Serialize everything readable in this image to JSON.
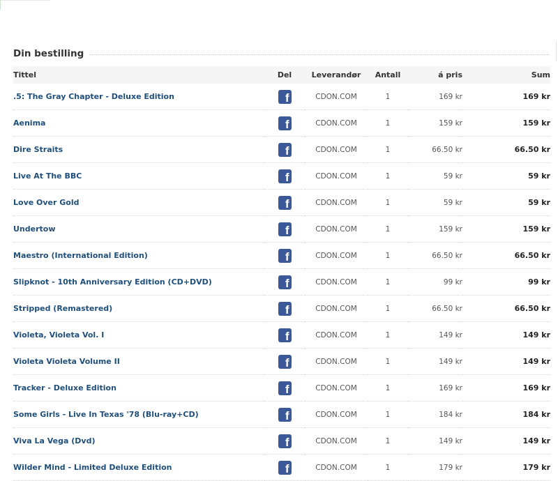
{
  "section": {
    "title": "Din bestilling"
  },
  "table": {
    "headers": {
      "title": "Tittel",
      "share": "Del",
      "supplier": "Leverandør",
      "quantity": "Antall",
      "unit_price": "á pris",
      "sum": "Sum"
    },
    "share_icon": "facebook-icon",
    "rows": [
      {
        "title": ".5: The Gray Chapter - Deluxe Edition",
        "supplier": "CDON.COM",
        "quantity": "1",
        "unit_price": "169 kr",
        "sum": "169 kr"
      },
      {
        "title": "Aenima",
        "supplier": "CDON.COM",
        "quantity": "1",
        "unit_price": "159 kr",
        "sum": "159 kr"
      },
      {
        "title": "Dire Straits",
        "supplier": "CDON.COM",
        "quantity": "1",
        "unit_price": "66.50 kr",
        "sum": "66.50 kr"
      },
      {
        "title": "Live At The BBC",
        "supplier": "CDON.COM",
        "quantity": "1",
        "unit_price": "59 kr",
        "sum": "59 kr"
      },
      {
        "title": "Love Over Gold",
        "supplier": "CDON.COM",
        "quantity": "1",
        "unit_price": "59 kr",
        "sum": "59 kr"
      },
      {
        "title": "Undertow",
        "supplier": "CDON.COM",
        "quantity": "1",
        "unit_price": "159 kr",
        "sum": "159 kr"
      },
      {
        "title": "Maestro (International Edition)",
        "supplier": "CDON.COM",
        "quantity": "1",
        "unit_price": "66.50 kr",
        "sum": "66.50 kr"
      },
      {
        "title": "Slipknot - 10th Anniversary Edition (CD+DVD)",
        "supplier": "CDON.COM",
        "quantity": "1",
        "unit_price": "99 kr",
        "sum": "99 kr"
      },
      {
        "title": "Stripped (Remastered)",
        "supplier": "CDON.COM",
        "quantity": "1",
        "unit_price": "66.50 kr",
        "sum": "66.50 kr"
      },
      {
        "title": "Violeta, Violeta Vol. I",
        "supplier": "CDON.COM",
        "quantity": "1",
        "unit_price": "149 kr",
        "sum": "149 kr"
      },
      {
        "title": "Violeta Violeta Volume II",
        "supplier": "CDON.COM",
        "quantity": "1",
        "unit_price": "149 kr",
        "sum": "149 kr"
      },
      {
        "title": "Tracker - Deluxe Edition",
        "supplier": "CDON.COM",
        "quantity": "1",
        "unit_price": "169 kr",
        "sum": "169 kr"
      },
      {
        "title": "Some Girls - Live In Texas '78 (Blu-ray+CD)",
        "supplier": "CDON.COM",
        "quantity": "1",
        "unit_price": "184 kr",
        "sum": "184 kr"
      },
      {
        "title": "Viva La Vega (Dvd)",
        "supplier": "CDON.COM",
        "quantity": "1",
        "unit_price": "149 kr",
        "sum": "149 kr"
      },
      {
        "title": "Wilder Mind - Limited Deluxe Edition",
        "supplier": "CDON.COM",
        "quantity": "1",
        "unit_price": "179 kr",
        "sum": "179 kr"
      }
    ]
  }
}
